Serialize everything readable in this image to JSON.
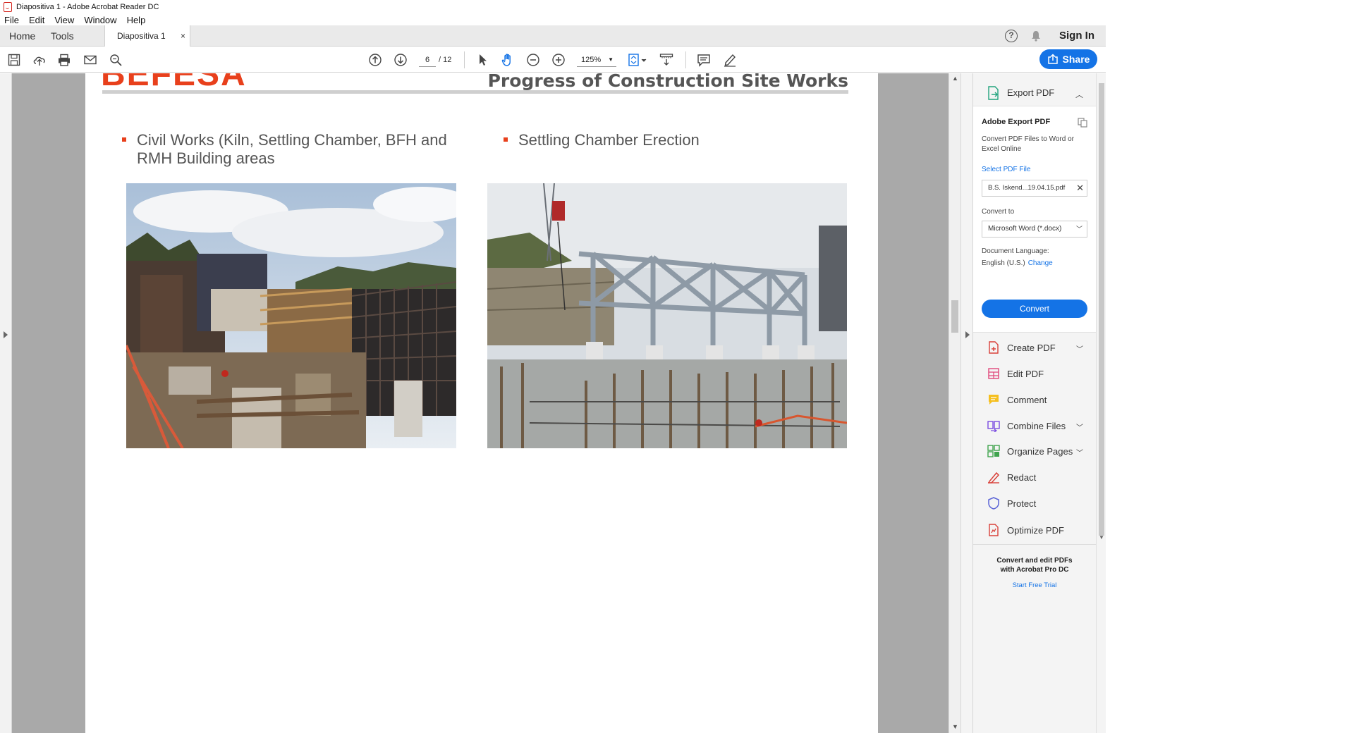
{
  "window": {
    "title": "Diapositiva 1 - Adobe Acrobat Reader DC",
    "controls": [
      "—",
      "❐",
      "✕"
    ]
  },
  "menu": [
    "File",
    "Edit",
    "View",
    "Window",
    "Help"
  ],
  "tabs": {
    "home": "Home",
    "tools": "Tools",
    "document": "Diapositiva 1",
    "close": "×"
  },
  "header_right": {
    "help": "?",
    "sign_in": "Sign In"
  },
  "toolbar": {
    "page_current": "6",
    "page_total": "/ 12",
    "zoom": "125%",
    "share": "Share"
  },
  "slide": {
    "logo": "BEFESA",
    "title": "Progress of Construction Site Works",
    "bullet_left": "Civil Works (Kiln, Settling Chamber, BFH and RMH Building areas",
    "bullet_right": "Settling Chamber Erection"
  },
  "pane": {
    "export_label": "Export PDF",
    "box_title": "Adobe Export PDF",
    "box_desc": "Convert PDF Files to Word or Excel Online",
    "select_label": "Select PDF File",
    "file_name": "B.S. Iskend...19.04.15.pdf",
    "convert_to_label": "Convert to",
    "convert_to_value": "Microsoft Word (*.docx)",
    "doc_lang_label": "Document Language:",
    "doc_lang_value": "English (U.S.)",
    "change": "Change",
    "convert_btn": "Convert",
    "tools": [
      {
        "label": "Create PDF",
        "chevron": true
      },
      {
        "label": "Edit PDF",
        "chevron": false
      },
      {
        "label": "Comment",
        "chevron": false
      },
      {
        "label": "Combine Files",
        "chevron": true
      },
      {
        "label": "Organize Pages",
        "chevron": true
      },
      {
        "label": "Redact",
        "chevron": false
      },
      {
        "label": "Protect",
        "chevron": false
      },
      {
        "label": "Optimize PDF",
        "chevron": false
      }
    ],
    "promo_text": "Convert and edit PDFs with Acrobat Pro DC",
    "promo_link": "Start Free Trial"
  },
  "colors": {
    "accent": "#1473e6",
    "brand_orange": "#e8401c"
  }
}
